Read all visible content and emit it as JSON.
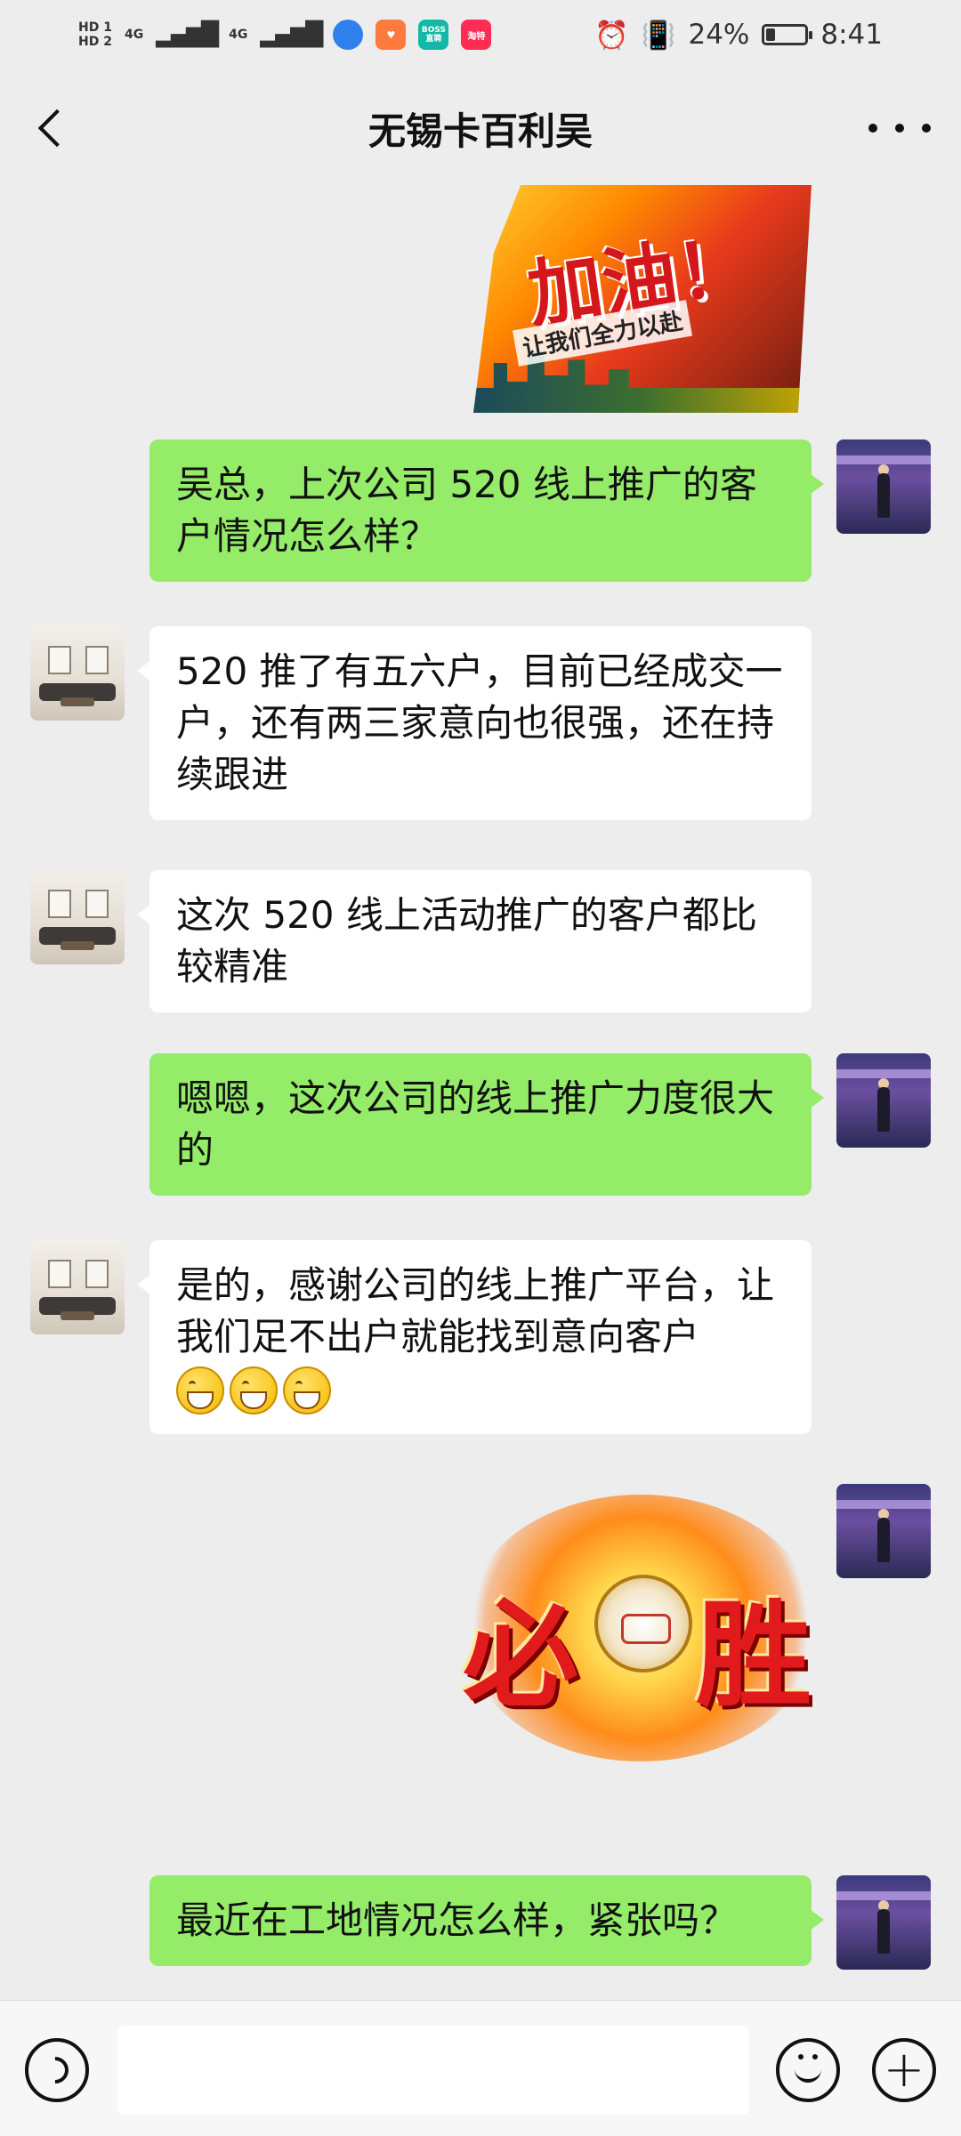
{
  "status_bar": {
    "hd1": "HD 1",
    "hd2": "HD 2",
    "net1": "4G",
    "net2": "4G",
    "app_boss": "BOSS 直聘",
    "app_taote": "淘特",
    "battery": "24%",
    "battery_level": 0.24,
    "time": "8:41"
  },
  "header": {
    "title": "无锡卡百利吴"
  },
  "messages": [
    {
      "side": "me",
      "type": "sticker",
      "sticker_text": "加油！",
      "sticker_sub": "让我们全力以赴"
    },
    {
      "side": "me",
      "type": "text",
      "text": "吴总，上次公司 520 线上推广的客户情况怎么样？"
    },
    {
      "side": "other",
      "type": "text",
      "text": "520 推了有五六户，目前已经成交一户，还有两三家意向也很强，还在持续跟进"
    },
    {
      "side": "other",
      "type": "text",
      "text": "这次 520 线上活动推广的客户都比较精准"
    },
    {
      "side": "me",
      "type": "text",
      "text": "嗯嗯，这次公司的线上推广力度很大的"
    },
    {
      "side": "other",
      "type": "text",
      "text": "是的，感谢公司的线上推广平台，让我们足不出户就能找到意向客户"
    },
    {
      "side": "me",
      "type": "sticker",
      "sticker_left": "必",
      "sticker_right": "胜"
    },
    {
      "side": "me",
      "type": "text",
      "text": "最近在工地情况怎么样，紧张吗？"
    }
  ],
  "input_bar": {
    "value": ""
  },
  "colors": {
    "my_bubble": "#95ec69",
    "their_bubble": "#ffffff",
    "background": "#ededed"
  }
}
